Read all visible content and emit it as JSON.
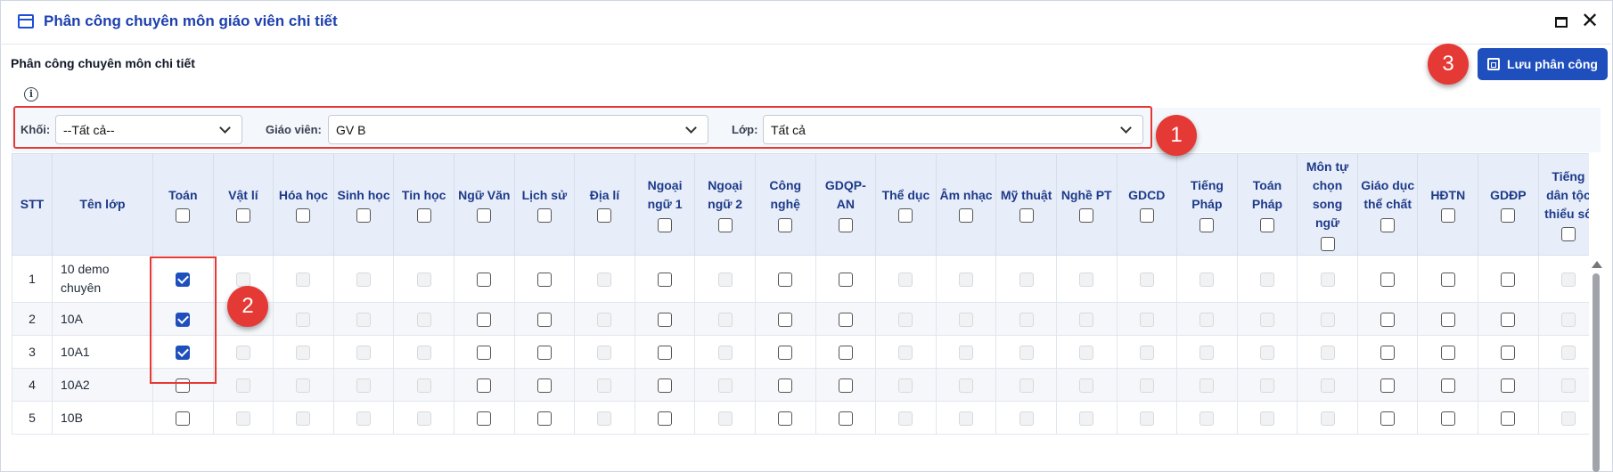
{
  "window": {
    "title": "Phân công chuyên môn giáo viên chi tiết"
  },
  "section": {
    "title": "Phân công chuyên môn chi tiết"
  },
  "toolbar": {
    "save_label": "Lưu phân công"
  },
  "filters": {
    "khoi": {
      "label": "Khối:",
      "value": "--Tất cả--"
    },
    "giao_vien": {
      "label": "Giáo viên:",
      "value": "GV B"
    },
    "lop": {
      "label": "Lớp:",
      "value": "Tất cả"
    }
  },
  "callouts": [
    "1",
    "2",
    "3"
  ],
  "table": {
    "columns": [
      "STT",
      "Tên lớp",
      "Toán",
      "Vật lí",
      "Hóa học",
      "Sinh học",
      "Tin học",
      "Ngữ Văn",
      "Lịch sử",
      "Địa lí",
      "Ngoại ngữ 1",
      "Ngoại ngữ 2",
      "Công nghệ",
      "GDQP-AN",
      "Thể dục",
      "Âm nhạc",
      "Mỹ thuật",
      "Nghề PT",
      "GDCD",
      "Tiếng Pháp",
      "Toán Pháp",
      "Môn tự chọn song ngữ",
      "Giáo dục thể chất",
      "HĐTN",
      "GDĐP",
      "Tiếng dân tộc thiểu số"
    ],
    "enabled_subjects": [
      "Toán",
      "Ngữ Văn",
      "Lịch sử",
      "Ngoại ngữ 1",
      "Công nghệ",
      "GDQP-AN",
      "Giáo dục thể chất",
      "HĐTN",
      "GDĐP"
    ],
    "rows": [
      {
        "stt": "1",
        "name": "10 demo chuyên",
        "checked": [
          "Toán"
        ]
      },
      {
        "stt": "2",
        "name": "10A",
        "checked": [
          "Toán"
        ]
      },
      {
        "stt": "3",
        "name": "10A1",
        "checked": [
          "Toán"
        ]
      },
      {
        "stt": "4",
        "name": "10A2",
        "checked": []
      },
      {
        "stt": "5",
        "name": "10B",
        "checked": []
      }
    ]
  },
  "colors": {
    "accent": "#1e4fbd",
    "annotation": "#e53935",
    "header_bg": "#e7eef9"
  }
}
